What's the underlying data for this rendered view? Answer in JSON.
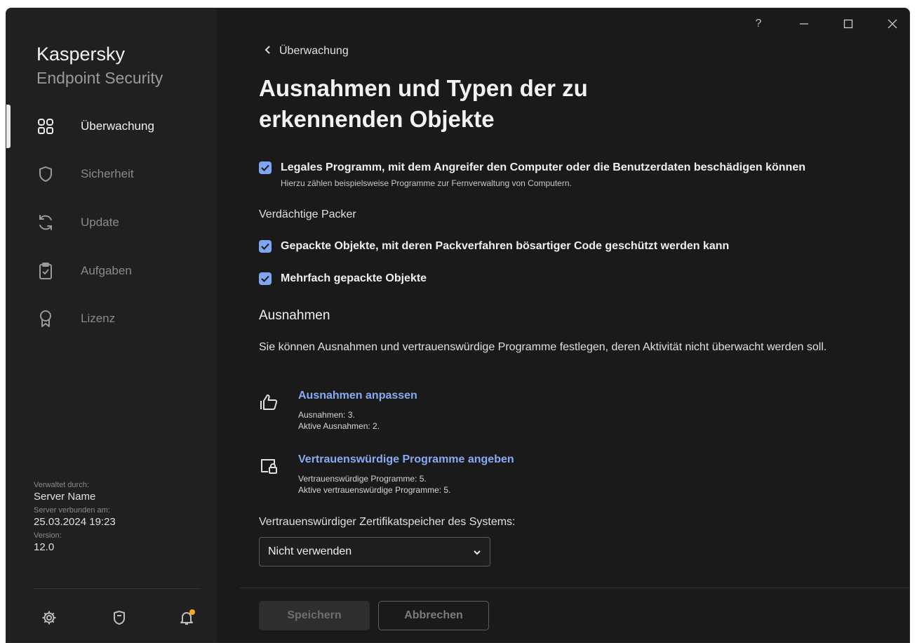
{
  "brand": {
    "title": "Kaspersky",
    "subtitle": "Endpoint Security"
  },
  "sidebar": {
    "items": [
      {
        "label": "Überwachung",
        "icon": "grid-icon",
        "active": true
      },
      {
        "label": "Sicherheit",
        "icon": "shield-icon",
        "active": false
      },
      {
        "label": "Update",
        "icon": "refresh-icon",
        "active": false
      },
      {
        "label": "Aufgaben",
        "icon": "clipboard-icon",
        "active": false
      },
      {
        "label": "Lizenz",
        "icon": "license-icon",
        "active": false
      }
    ],
    "meta": {
      "managed_by_label": "Verwaltet durch:",
      "managed_by_value": "Server Name",
      "connected_label": "Server verbunden am:",
      "connected_value": "25.03.2024 19:23",
      "version_label": "Version:",
      "version_value": "12.0"
    },
    "bottom_icons": [
      "gear-icon",
      "support-icon",
      "bell-icon"
    ],
    "notification_color": "#f6a91d"
  },
  "titlebar": {
    "help": "?",
    "minimize": "—",
    "maximize": "☐",
    "close": "✕"
  },
  "header": {
    "back_label": "Überwachung",
    "page_title": "Ausnahmen und Typen der zu erkennenden Objekte"
  },
  "options": {
    "legal_program": {
      "label": "Legales Programm, mit dem Angreifer den Computer oder die Benutzerdaten beschädigen können",
      "hint": "Hierzu zählen beispielsweise Programme zur Fernverwaltung von Computern.",
      "checked": true
    },
    "packer_heading": "Verdächtige Packer",
    "packed_objects": {
      "label": "Gepackte Objekte, mit deren Packverfahren bösartiger Code geschützt werden kann",
      "checked": true
    },
    "multi_packed": {
      "label": "Mehrfach gepackte Objekte",
      "checked": true
    }
  },
  "exclusions": {
    "heading": "Ausnahmen",
    "description": "Sie können Ausnahmen und vertrauenswürdige Programme festlegen, deren Aktivität nicht überwacht werden soll.",
    "configure": {
      "link": "Ausnahmen anpassen",
      "line1": "Ausnahmen: 3.",
      "line2": "Aktive Ausnahmen: 2."
    },
    "trusted": {
      "link": "Vertrauenswürdige Programme angeben",
      "line1": "Vertrauenswürdige Programme: 5.",
      "line2": "Aktive vertrauenswürdige Programme: 5."
    },
    "cert_store_label": "Vertrauenswürdiger Zertifikatspeicher des Systems:",
    "cert_store_value": "Nicht verwenden"
  },
  "footer": {
    "save": "Speichern",
    "cancel": "Abbrechen"
  },
  "colors": {
    "accent": "#7fa6f0",
    "link": "#89abf4",
    "background": "#1a1a1a",
    "sidebar": "#202020"
  }
}
